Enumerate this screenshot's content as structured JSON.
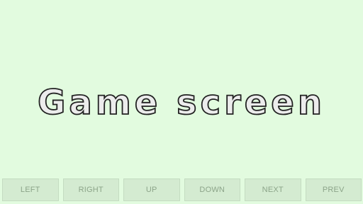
{
  "screen": {
    "title": "Game screen",
    "background_color": "#e2fbdf"
  },
  "controls": {
    "left_label": "LEFT",
    "right_label": "RIGHT",
    "up_label": "UP",
    "down_label": "DOWN",
    "next_label": "NEXT",
    "prev_label": "PREV",
    "button_color": "#d4ebd1"
  }
}
